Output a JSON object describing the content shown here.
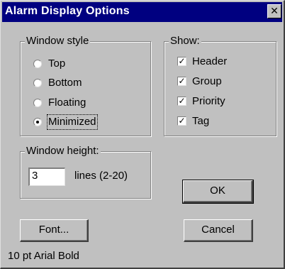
{
  "dialog": {
    "title": "Alarm Display Options",
    "close_glyph": "✕"
  },
  "window_style": {
    "label": "Window style",
    "options": [
      {
        "label": "Top",
        "selected": false
      },
      {
        "label": "Bottom",
        "selected": false
      },
      {
        "label": "Floating",
        "selected": false
      },
      {
        "label": "Minimized",
        "selected": true
      }
    ]
  },
  "show": {
    "label": "Show:",
    "items": [
      {
        "label": "Header",
        "checked": true
      },
      {
        "label": "Group",
        "checked": true
      },
      {
        "label": "Priority",
        "checked": true
      },
      {
        "label": "Tag",
        "checked": true
      }
    ]
  },
  "window_height": {
    "label": "Window height:",
    "value": "3",
    "suffix": "lines (2-20)"
  },
  "buttons": {
    "ok": "OK",
    "cancel": "Cancel",
    "font": "Font..."
  },
  "font_info": "10 pt Arial Bold",
  "colors": {
    "titlebar": "#000080",
    "face": "#c0c0c0"
  }
}
